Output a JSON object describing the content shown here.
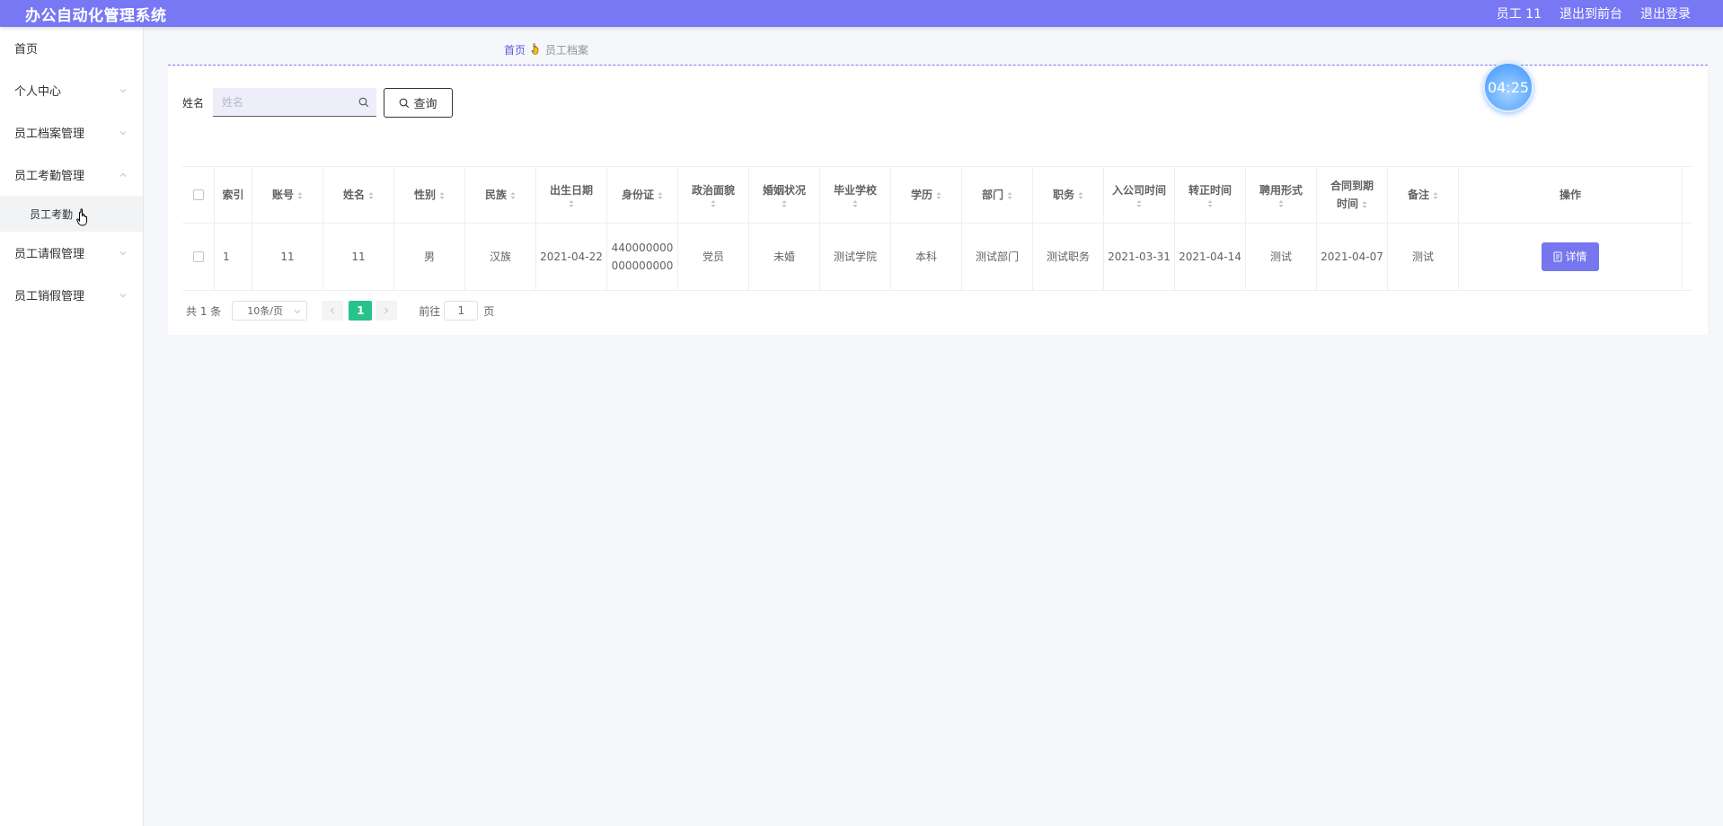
{
  "app": {
    "title": "办公自动化管理系统"
  },
  "header": {
    "user": "员工 11",
    "front_link": "退出到前台",
    "logout": "退出登录"
  },
  "sidebar": {
    "items": [
      {
        "label": "首页",
        "has_children": false
      },
      {
        "label": "个人中心",
        "has_children": true
      },
      {
        "label": "员工档案管理",
        "has_children": true
      },
      {
        "label": "员工考勤管理",
        "has_children": true,
        "expanded": true,
        "children": [
          {
            "label": "员工考勤",
            "active": true
          }
        ]
      },
      {
        "label": "员工请假管理",
        "has_children": true
      },
      {
        "label": "员工销假管理",
        "has_children": true
      }
    ]
  },
  "breadcrumb": {
    "home": "首页",
    "current": "员工档案"
  },
  "timer": "04:25",
  "search": {
    "label": "姓名",
    "placeholder": "姓名",
    "value": "",
    "button": "查询"
  },
  "table": {
    "columns": [
      "索引",
      "账号",
      "姓名",
      "性别",
      "民族",
      "出生日期",
      "身份证",
      "政治面貌",
      "婚姻状况",
      "毕业学校",
      "学历",
      "部门",
      "职务",
      "入公司时间",
      "转正时间",
      "聘用形式",
      "合同到期时间",
      "备注",
      "操作"
    ],
    "rows": [
      {
        "cells": [
          "1",
          "11",
          "11",
          "男",
          "汉族",
          "2021-04-22",
          "440000000000000000",
          "党员",
          "未婚",
          "测试学院",
          "本科",
          "测试部门",
          "测试职务",
          "2021-03-31",
          "2021-04-14",
          "测试",
          "2021-04-07",
          "测试"
        ],
        "action": "详情"
      }
    ]
  },
  "pagination": {
    "total_text": "共 1 条",
    "page_size": "10条/页",
    "current_page": "1",
    "goto_label": "前往",
    "goto_value": "1",
    "page_suffix": "页"
  },
  "colors": {
    "header": "#7878f4",
    "button": "#7676ee",
    "active_page": "#28c28c"
  }
}
